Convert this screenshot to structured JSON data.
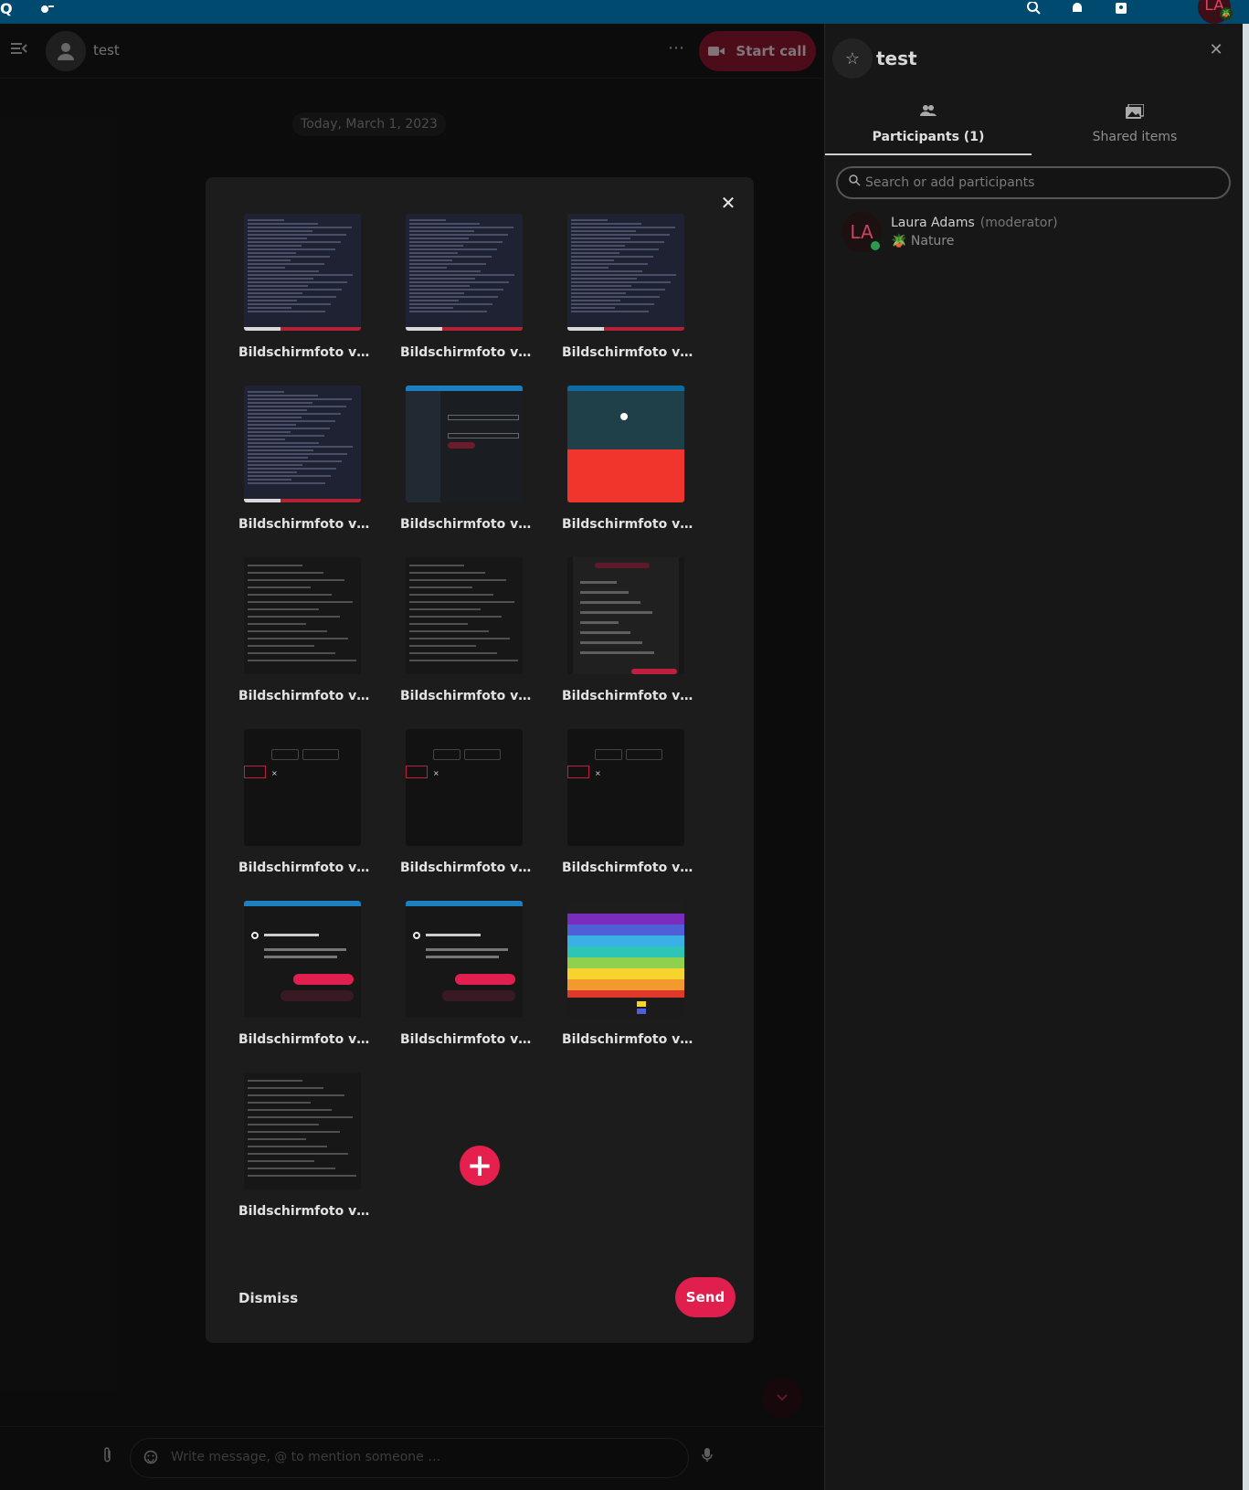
{
  "topbar": {
    "logo": "Q",
    "icons": [
      "search-icon",
      "bell-icon",
      "contacts-icon"
    ],
    "user_initials": "LA"
  },
  "chat": {
    "title": "test",
    "start_call_label": "Start call",
    "date_separator": "Today, March 1, 2023",
    "composer_placeholder": "Write message, @ to mention someone …"
  },
  "sidebar": {
    "title": "test",
    "tabs": [
      {
        "label": "Participants (1)",
        "active": true
      },
      {
        "label": "Shared items",
        "active": false
      }
    ],
    "search_placeholder": "Search or add participants",
    "participants": [
      {
        "initials": "LA",
        "name": "Laura Adams",
        "role": "(moderator)",
        "status_emoji": "🪴",
        "status": "Nature"
      }
    ]
  },
  "upload_dialog": {
    "files": [
      {
        "name": "Bildschirmfoto v…",
        "thumb": "terminal"
      },
      {
        "name": "Bildschirmfoto v…",
        "thumb": "terminal"
      },
      {
        "name": "Bildschirmfoto v…",
        "thumb": "terminal"
      },
      {
        "name": "Bildschirmfoto v…",
        "thumb": "terminal"
      },
      {
        "name": "Bildschirmfoto v…",
        "thumb": "settings"
      },
      {
        "name": "Bildschirmfoto v…",
        "thumb": "red-page"
      },
      {
        "name": "Bildschirmfoto v…",
        "thumb": "chat"
      },
      {
        "name": "Bildschirmfoto v…",
        "thumb": "text"
      },
      {
        "name": "Bildschirmfoto v…",
        "thumb": "status-menu"
      },
      {
        "name": "Bildschirmfoto v…",
        "thumb": "tag-filter"
      },
      {
        "name": "Bildschirmfoto v…",
        "thumb": "tag-filter"
      },
      {
        "name": "Bildschirmfoto v…",
        "thumb": "tag-filter"
      },
      {
        "name": "Bildschirmfoto v…",
        "thumb": "notification"
      },
      {
        "name": "Bildschirmfoto v…",
        "thumb": "notification"
      },
      {
        "name": "Bildschirmfoto v…",
        "thumb": "cpu-chart"
      },
      {
        "name": "Bildschirmfoto v…",
        "thumb": "chat-log"
      }
    ],
    "dismiss_label": "Dismiss",
    "send_label": "Send",
    "add_label": "+"
  },
  "colors": {
    "topbar": "#00496f",
    "accent": "#e01f4e",
    "call_button": "#8a1731",
    "background": "#171717"
  }
}
